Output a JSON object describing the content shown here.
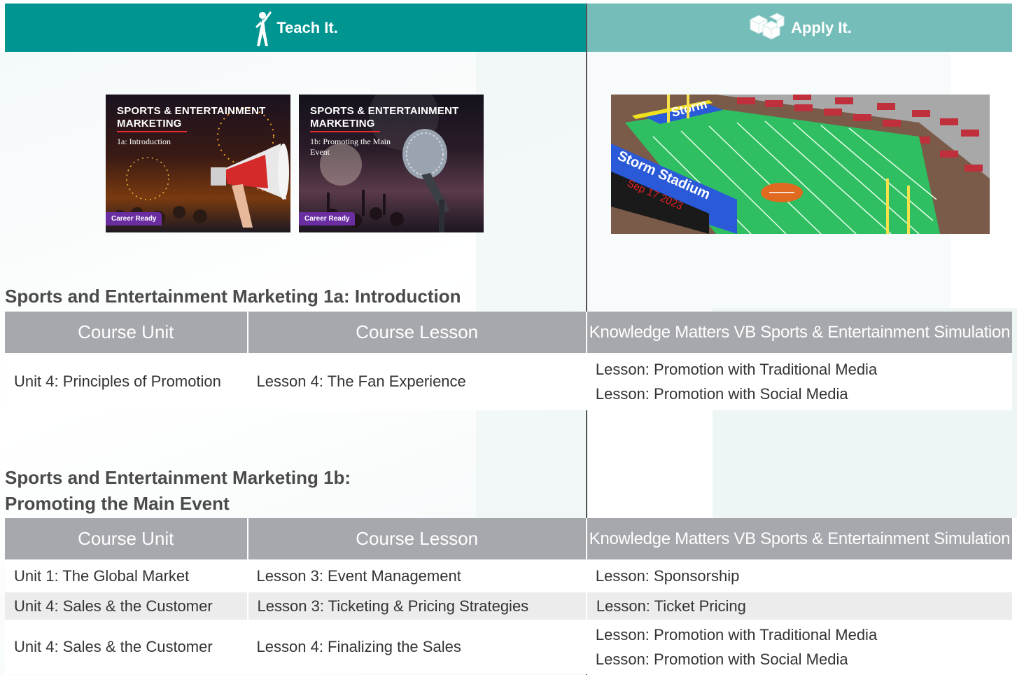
{
  "headers": {
    "teach": "Teach It.",
    "apply": "Apply It."
  },
  "thumbnails": [
    {
      "title": "SPORTS & ENTERTAINMENT MARKETING",
      "subtitle": "1a: Introduction",
      "badge": "Career Ready"
    },
    {
      "title": "SPORTS & ENTERTAINMENT MARKETING",
      "subtitle": "1b: Promoting the Main Event",
      "badge": "Career Ready"
    }
  ],
  "stadium": {
    "banner_text": "Storm Stadium",
    "end_zone_text": "Storm",
    "date_text": "Sep 17 2023"
  },
  "table_headers": {
    "unit": "Course Unit",
    "lesson": "Course Lesson",
    "simulation": "Knowledge Matters VB Sports & Entertainment Simulation"
  },
  "section1": {
    "title": "Sports and Entertainment Marketing 1a: Introduction",
    "rows": [
      {
        "unit": "Unit 4: Principles of Promotion",
        "lesson": "Lesson 4: The Fan Experience",
        "simulation": [
          "Lesson: Promotion with Traditional Media",
          "Lesson: Promotion with Social Media"
        ]
      }
    ]
  },
  "section2": {
    "title_line1": "Sports and Entertainment Marketing 1b:",
    "title_line2": "Promoting the Main Event",
    "rows": [
      {
        "unit": "Unit 1: The Global Market",
        "lesson": "Lesson 3: Event Management",
        "simulation": [
          "Lesson: Sponsorship"
        ]
      },
      {
        "unit": "Unit 4: Sales & the Customer",
        "lesson": "Lesson 3: Ticketing & Pricing Strategies",
        "simulation": [
          "Lesson: Ticket Pricing"
        ]
      },
      {
        "unit": "Unit 4: Sales & the Customer",
        "lesson": "Lesson 4: Finalizing the Sales",
        "simulation": [
          "Lesson: Promotion with Traditional Media",
          "Lesson: Promotion with Social Media"
        ]
      }
    ]
  },
  "colors": {
    "teach_header": "#009591",
    "apply_header": "#74bdb9",
    "table_header": "#a7a8ad",
    "alt_row": "#ececec"
  }
}
